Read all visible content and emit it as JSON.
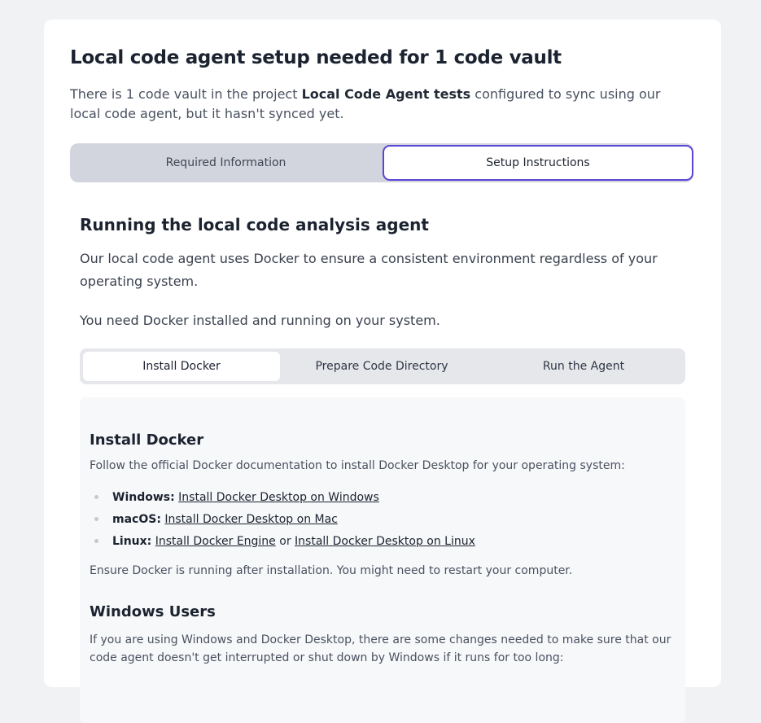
{
  "header": {
    "title": "Local code agent setup needed for 1 code vault",
    "intro_before": "There is 1 code vault in the project ",
    "project_name": "Local Code Agent tests",
    "intro_after": " configured to sync using our local code agent, but it hasn't synced yet."
  },
  "main_tabs": [
    {
      "label": "Required Information"
    },
    {
      "label": "Setup Instructions"
    }
  ],
  "section": {
    "title": "Running the local code analysis agent",
    "para1": "Our local code agent uses Docker to ensure a consistent environment regardless of your operating system.",
    "para2": "You need Docker installed and running on your system."
  },
  "sub_tabs": [
    {
      "label": "Install Docker"
    },
    {
      "label": "Prepare Code Directory"
    },
    {
      "label": "Run the Agent"
    }
  ],
  "panel": {
    "heading": "Install Docker",
    "intro": "Follow the official Docker documentation to install Docker Desktop for your operating system:",
    "items": [
      {
        "os": "Windows:",
        "link1": "Install Docker Desktop on Windows"
      },
      {
        "os": "macOS:",
        "link1": "Install Docker Desktop on Mac"
      },
      {
        "os": "Linux:",
        "link1": "Install Docker Engine",
        "joiner": " or ",
        "link2": "Install Docker Desktop on Linux"
      }
    ],
    "after": "Ensure Docker is running after installation. You might need to restart your computer.",
    "heading2": "Windows Users",
    "windows_text": "If you are using Windows and Docker Desktop, there are some changes needed to make sure that our code agent doesn't get interrupted or shut down by Windows if it runs for too long:"
  },
  "colors": {
    "accent": "#5b45d6",
    "background": "#f1f2f4"
  }
}
